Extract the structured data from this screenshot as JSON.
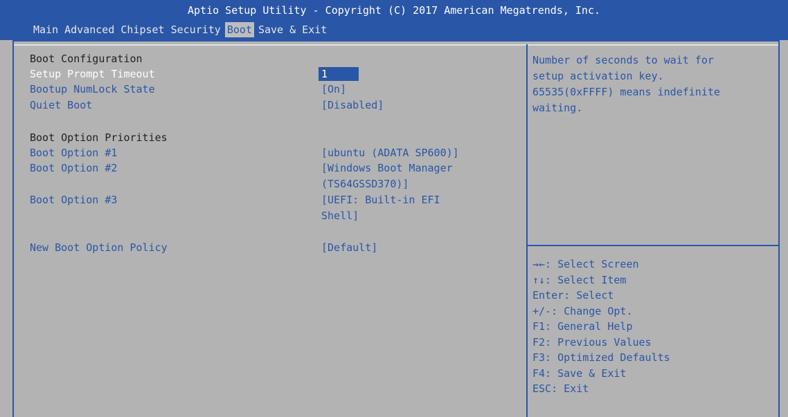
{
  "header": {
    "title": "Aptio Setup Utility - Copyright (C) 2017 American Megatrends, Inc.",
    "tabs": [
      "Main",
      "Advanced",
      "Chipset",
      "Security",
      "Boot",
      "Save & Exit"
    ],
    "active_tab": "Boot"
  },
  "boot": {
    "section1_heading": "Boot Configuration",
    "setup_prompt_label": "Setup Prompt Timeout",
    "setup_prompt_value": "1",
    "numlock_label": "Bootup NumLock State",
    "numlock_value": "[On]",
    "quiet_label": "Quiet Boot",
    "quiet_value": "[Disabled]",
    "section2_heading": "Boot Option Priorities",
    "opt1_label": "Boot Option #1",
    "opt1_value": "[ubuntu (ADATA SP600)]",
    "opt2_label": "Boot Option #2",
    "opt2_value_line1": "[Windows Boot Manager",
    "opt2_value_line2": "(TS64GSSD370)]",
    "opt3_label": "Boot Option #3",
    "opt3_value_line1": "[UEFI: Built-in EFI",
    "opt3_value_line2": "Shell]",
    "policy_label": "New Boot Option Policy",
    "policy_value": "[Default]"
  },
  "help": {
    "line1": "Number of seconds to wait for",
    "line2": "setup activation key.",
    "line3": "65535(0xFFFF) means indefinite",
    "line4": "waiting."
  },
  "keys": [
    "→←: Select Screen",
    "↑↓: Select Item",
    "Enter: Select",
    "+/-: Change Opt.",
    "F1: General Help",
    "F2: Previous Values",
    "F3: Optimized Defaults",
    "F4: Save & Exit",
    "ESC: Exit"
  ],
  "colors": {
    "accent": "#2a56a7",
    "background": "#b3b3b3",
    "heading_text": "#222222",
    "selected_text": "#ffffff"
  }
}
